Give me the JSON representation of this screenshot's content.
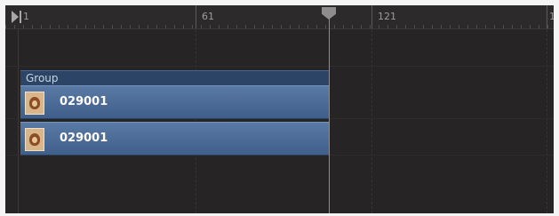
{
  "ruler": {
    "labels": [
      "1",
      "61",
      "121",
      "1"
    ]
  },
  "timeline": {
    "group": {
      "label": "Group"
    },
    "clips": [
      {
        "label": "029001",
        "thumbnail": "image-thumbnail"
      },
      {
        "label": "029001",
        "thumbnail": "image-thumbnail"
      }
    ]
  },
  "colors": {
    "background": "#262424",
    "group_bar": "#2c4466",
    "clip": "#4f6e99",
    "playhead": "#8e8c8c"
  }
}
